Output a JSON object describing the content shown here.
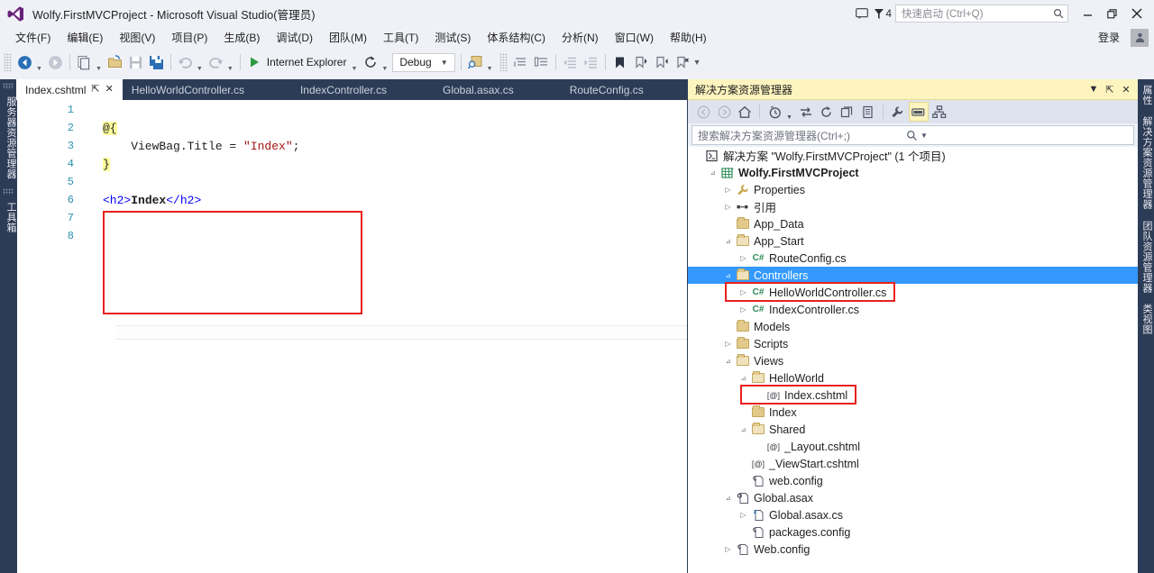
{
  "window": {
    "title": "Wolfy.FirstMVCProject - Microsoft Visual Studio(管理员)",
    "logo_icon": "visual-studio-logo",
    "notifications_icon": "feedback-icon",
    "warning_icon": "notification-flag-icon",
    "notification_count": "4",
    "minimize_icon": "minimize-icon",
    "restore_icon": "restore-icon",
    "close_icon": "close-icon",
    "quick_launch_placeholder": "快速启动 (Ctrl+Q)",
    "quick_launch_value": "",
    "search_icon": "search-icon"
  },
  "menubar": {
    "items": [
      {
        "label": "文件(F)"
      },
      {
        "label": "编辑(E)"
      },
      {
        "label": "视图(V)"
      },
      {
        "label": "项目(P)"
      },
      {
        "label": "生成(B)"
      },
      {
        "label": "调试(D)"
      },
      {
        "label": "团队(M)"
      },
      {
        "label": "工具(T)"
      },
      {
        "label": "测试(S)"
      },
      {
        "label": "体系结构(C)"
      },
      {
        "label": "分析(N)"
      },
      {
        "label": "窗口(W)"
      },
      {
        "label": "帮助(H)"
      }
    ],
    "signin_label": "登录",
    "account_icon": "account-icon"
  },
  "toolbar": {
    "back_icon": "navigate-back-icon",
    "forward_icon": "navigate-forward-icon",
    "new_project_icon": "new-project-icon",
    "open_file_icon": "open-file-icon",
    "save_icon": "save-icon",
    "save_all_icon": "save-all-icon",
    "undo_icon": "undo-icon",
    "redo_icon": "redo-icon",
    "start_icon": "start-debug-icon",
    "start_label": "Internet Explorer",
    "refresh_icon": "refresh-icon",
    "config_value": "Debug",
    "find_icon": "find-in-files-icon",
    "comment_icon": "comment-selection-icon",
    "uncomment_icon": "uncomment-selection-icon",
    "outdent_icon": "decrease-indent-icon",
    "indent_icon": "increase-indent-icon",
    "bookmark_icon": "toggle-bookmark-icon",
    "prev_bookmark_icon": "previous-bookmark-icon",
    "next_bookmark_icon": "next-bookmark-icon",
    "clear_bookmarks_icon": "clear-bookmarks-icon",
    "overflow_icon": "toolbar-overflow-icon"
  },
  "left_dock": {
    "tabs": [
      {
        "label": "服务器资源管理器"
      },
      {
        "label": "工具箱"
      }
    ]
  },
  "right_dock": {
    "tabs": [
      {
        "label": "属性"
      },
      {
        "label": "解决方案资源管理器"
      },
      {
        "label": "团队资源管理器"
      },
      {
        "label": "类视图"
      }
    ]
  },
  "editor": {
    "tabs": [
      {
        "label": "Index.cshtml",
        "active": true,
        "pin_icon": "pin-icon",
        "close_icon": "close-tab-icon"
      },
      {
        "label": "HelloWorldController.cs",
        "active": false
      },
      {
        "label": "IndexController.cs",
        "active": false
      },
      {
        "label": "Global.asax.cs",
        "active": false
      },
      {
        "label": "RouteConfig.cs",
        "active": false
      }
    ],
    "line_numbers": [
      "1",
      "2",
      "3",
      "4",
      "5",
      "6",
      "7",
      "8"
    ],
    "code_lines": [
      {
        "n": 1,
        "segments": []
      },
      {
        "n": 2,
        "segments": [
          {
            "t": "@{",
            "k": "yellow"
          }
        ]
      },
      {
        "n": 3,
        "segments": [
          {
            "t": "    ViewBag.Title = ",
            "k": "plain"
          },
          {
            "t": "\"Index\"",
            "k": "string"
          },
          {
            "t": ";",
            "k": "plain"
          }
        ]
      },
      {
        "n": 4,
        "segments": [
          {
            "t": "}",
            "k": "yellow"
          }
        ]
      },
      {
        "n": 5,
        "segments": []
      },
      {
        "n": 6,
        "segments": [
          {
            "t": "<h2>",
            "k": "tag"
          },
          {
            "t": "Index",
            "k": "bold"
          },
          {
            "t": "</h2>",
            "k": "tag"
          }
        ]
      },
      {
        "n": 7,
        "segments": []
      },
      {
        "n": 8,
        "segments": []
      }
    ],
    "highlight_label": "code-highlight-rectangle"
  },
  "solution_explorer": {
    "title": "解决方案资源管理器",
    "dropdown_icon": "chevron-down-icon",
    "pin_icon": "pin-icon",
    "close_icon": "close-icon",
    "toolbar": [
      {
        "name": "back-icon",
        "glyph": "back",
        "state": "disabled"
      },
      {
        "name": "forward-icon",
        "glyph": "forward",
        "state": "disabled"
      },
      {
        "name": "home-icon",
        "glyph": "home",
        "state": "normal"
      },
      {
        "name": "pending-changes-icon",
        "glyph": "clock",
        "state": "normal"
      },
      {
        "name": "sync-with-active-document-icon",
        "glyph": "sync",
        "state": "normal"
      },
      {
        "name": "refresh-icon",
        "glyph": "refresh",
        "state": "normal"
      },
      {
        "name": "collapse-all-icon",
        "glyph": "collapse",
        "state": "normal"
      },
      {
        "name": "show-all-files-icon",
        "glyph": "allfiles",
        "state": "normal"
      },
      {
        "name": "properties-icon",
        "glyph": "wrench",
        "state": "normal"
      },
      {
        "name": "preview-selected-items-icon",
        "glyph": "preview",
        "state": "selected"
      },
      {
        "name": "view-class-diagram-icon",
        "glyph": "classdiagram",
        "state": "normal"
      }
    ],
    "search_placeholder": "搜索解决方案资源管理器(Ctrl+;)",
    "search_value": "",
    "search_icon": "search-icon",
    "search_dropdown_icon": "chevron-down-icon",
    "tree": [
      {
        "label": "解决方案 \"Wolfy.FirstMVCProject\" (1 个项目)",
        "indent": 0,
        "expander": "",
        "icon": "solution-icon",
        "bold": false,
        "selected": false
      },
      {
        "label": "Wolfy.FirstMVCProject",
        "indent": 1,
        "expander": "expanded",
        "icon": "project-icon",
        "bold": true,
        "selected": false
      },
      {
        "label": "Properties",
        "indent": 2,
        "expander": "collapsed",
        "icon": "wrench-icon",
        "bold": false,
        "selected": false
      },
      {
        "label": "引用",
        "indent": 2,
        "expander": "collapsed",
        "icon": "references-icon",
        "bold": false,
        "selected": false
      },
      {
        "label": "App_Data",
        "indent": 2,
        "expander": "",
        "icon": "folder-icon",
        "bold": false,
        "selected": false
      },
      {
        "label": "App_Start",
        "indent": 2,
        "expander": "expanded",
        "icon": "folder-open-icon",
        "bold": false,
        "selected": false
      },
      {
        "label": "RouteConfig.cs",
        "indent": 3,
        "expander": "collapsed",
        "icon": "csharp-file-icon",
        "bold": false,
        "selected": false
      },
      {
        "label": "Controllers",
        "indent": 2,
        "expander": "expanded",
        "icon": "folder-open-icon",
        "bold": false,
        "selected": true
      },
      {
        "label": "HelloWorldController.cs",
        "indent": 3,
        "expander": "collapsed",
        "icon": "csharp-file-icon",
        "bold": false,
        "selected": false
      },
      {
        "label": "IndexController.cs",
        "indent": 3,
        "expander": "collapsed",
        "icon": "csharp-file-icon",
        "bold": false,
        "selected": false
      },
      {
        "label": "Models",
        "indent": 2,
        "expander": "",
        "icon": "folder-icon",
        "bold": false,
        "selected": false
      },
      {
        "label": "Scripts",
        "indent": 2,
        "expander": "collapsed",
        "icon": "folder-icon",
        "bold": false,
        "selected": false
      },
      {
        "label": "Views",
        "indent": 2,
        "expander": "expanded",
        "icon": "folder-open-icon",
        "bold": false,
        "selected": false
      },
      {
        "label": "HelloWorld",
        "indent": 3,
        "expander": "expanded",
        "icon": "folder-open-icon",
        "bold": false,
        "selected": false
      },
      {
        "label": "Index.cshtml",
        "indent": 4,
        "expander": "",
        "icon": "razor-file-icon",
        "bold": false,
        "selected": false
      },
      {
        "label": "Index",
        "indent": 3,
        "expander": "",
        "icon": "folder-icon",
        "bold": false,
        "selected": false
      },
      {
        "label": "Shared",
        "indent": 3,
        "expander": "expanded",
        "icon": "folder-open-icon",
        "bold": false,
        "selected": false
      },
      {
        "label": "_Layout.cshtml",
        "indent": 4,
        "expander": "",
        "icon": "razor-file-icon",
        "bold": false,
        "selected": false
      },
      {
        "label": "_ViewStart.cshtml",
        "indent": 3,
        "expander": "",
        "icon": "razor-file-icon",
        "bold": false,
        "selected": false
      },
      {
        "label": "web.config",
        "indent": 3,
        "expander": "",
        "icon": "config-file-icon",
        "bold": false,
        "selected": false
      },
      {
        "label": "Global.asax",
        "indent": 2,
        "expander": "expanded",
        "icon": "asax-file-icon",
        "bold": false,
        "selected": false
      },
      {
        "label": "Global.asax.cs",
        "indent": 3,
        "expander": "collapsed",
        "icon": "code-file-icon",
        "bold": false,
        "selected": false
      },
      {
        "label": "packages.config",
        "indent": 3,
        "expander": "",
        "icon": "config-file-icon",
        "bold": false,
        "selected": false
      },
      {
        "label": "Web.config",
        "indent": 2,
        "expander": "collapsed",
        "icon": "config-file-icon",
        "bold": false,
        "selected": false
      }
    ],
    "highlights": [
      {
        "name": "helloworldcontroller-highlight",
        "row": 8
      },
      {
        "name": "index-cshtml-highlight",
        "row": 14
      }
    ]
  },
  "colors": {
    "accent_blue": "#3399ff",
    "highlight_red": "#e8201e",
    "dock_navy": "#2d3c56",
    "panel_yellow": "#fdf4bf",
    "chrome_bg": "#eff1f7"
  }
}
